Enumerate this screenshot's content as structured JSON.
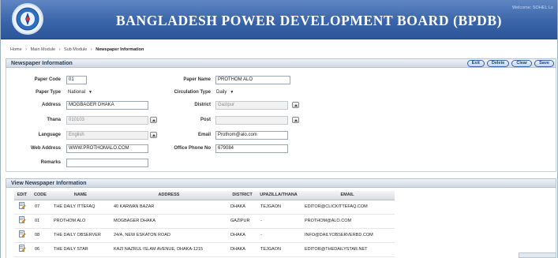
{
  "header": {
    "title": "BANGLADESH POWER DEVELOPMENT BOARD (BPDB)",
    "welcome": "Welcome: SOHEL  Lo"
  },
  "breadcrumb": {
    "items": [
      "Home",
      "Main Module",
      "Sub Module",
      "Newspaper Information"
    ],
    "separator": "›"
  },
  "form_section": {
    "title": "Newspaper Information",
    "buttons": {
      "exit": "Exit",
      "delete": "Delete",
      "clear": "Clear",
      "save": "Save"
    }
  },
  "form": {
    "paper_code": {
      "label": "Paper Code",
      "value": "01"
    },
    "paper_name": {
      "label": "Paper Name",
      "value": "PROTHOM ALO"
    },
    "paper_type": {
      "label": "Paper Type",
      "value": "National"
    },
    "circulation_type": {
      "label": "Circulation Type",
      "value": "Daily"
    },
    "address": {
      "label": "Address",
      "value": "MOGBAGER DHAKA"
    },
    "district": {
      "label": "District",
      "value": "Gazipur"
    },
    "thana": {
      "label": "Thana",
      "value": "010103"
    },
    "post": {
      "label": "Post",
      "value": ""
    },
    "language": {
      "label": "Language",
      "value": "English"
    },
    "email": {
      "label": "Email",
      "value": "Prothom@alo.com"
    },
    "web_address": {
      "label": "Web Address",
      "value": "WWW.PROTHOMALO.COM"
    },
    "office_phone": {
      "label": "Office Phone No",
      "value": "679084"
    },
    "remarks": {
      "label": "Remarks",
      "value": ""
    }
  },
  "list_section": {
    "title": "View Newspaper Information"
  },
  "table": {
    "columns": [
      "EDIT",
      "CODE",
      "NAME",
      "ADDRESS",
      "DISTRICT",
      "UPAZILLA/THANA",
      "EMAIL"
    ],
    "rows": [
      [
        "07",
        "THE DAILY ITTEFAQ",
        "40 KARWAN BAZAR",
        "DHAKA",
        "TEJGAON",
        "EDITOR@CLICKITTEFAQ.COM"
      ],
      [
        "01",
        "PROTHOM ALO",
        "MOGBAGER DHAKA",
        "GAZIPUR",
        "-",
        "PROTHOM@ALO.COM"
      ],
      [
        "08",
        "THE DAILY OBSERVER",
        "24/A, NEW ESKATON ROAD",
        "DHAKA",
        "-",
        "INFO@DAILYOBSERVERBD.COM"
      ],
      [
        "06",
        "THE DAILY STAR",
        "KAZI NAZRUL ISLAM AVENUE, DHAKA-1215",
        "DHAKA",
        "TEJGAON",
        "EDITOR@THEDAILYSTAR.NET"
      ]
    ]
  },
  "colors": {
    "banner": "#3a65aa",
    "button_border": "#3a64a8",
    "section_bar": "#cfd8e2"
  },
  "icons": {
    "logo": "bpdb-logo-icon",
    "edit": "edit-record-icon",
    "lookup": "lookup-icon"
  }
}
